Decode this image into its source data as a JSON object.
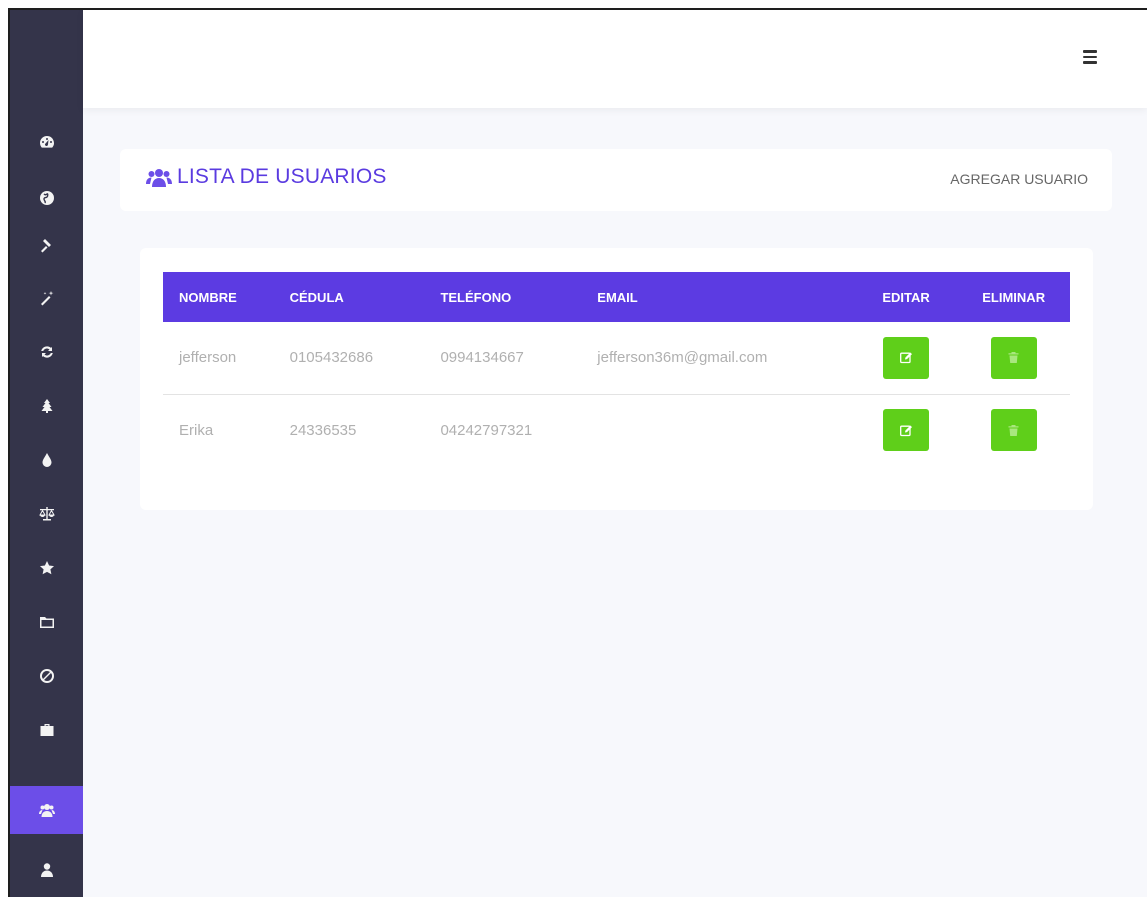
{
  "sidebar": {
    "items": [
      {
        "icon": "dashboard-icon"
      },
      {
        "icon": "globe-icon"
      },
      {
        "icon": "gavel-icon"
      },
      {
        "icon": "magic-wand-icon"
      },
      {
        "icon": "refresh-icon"
      },
      {
        "icon": "tree-icon"
      },
      {
        "icon": "tint-icon"
      },
      {
        "icon": "balance-scale-icon"
      },
      {
        "icon": "star-icon"
      },
      {
        "icon": "folder-icon"
      },
      {
        "icon": "ban-icon"
      },
      {
        "icon": "briefcase-icon"
      },
      {
        "icon": "users-icon",
        "active": true
      },
      {
        "icon": "user-icon"
      }
    ]
  },
  "header": {
    "title": "LISTA DE USUARIOS",
    "add_label": "AGREGAR USUARIO"
  },
  "table": {
    "columns": [
      "NOMBRE",
      "CÉDULA",
      "TELÉFONO",
      "EMAIL",
      "EDITAR",
      "ELIMINAR"
    ],
    "rows": [
      {
        "nombre": "jefferson",
        "cedula": "0105432686",
        "telefono": "0994134667",
        "email": "jefferson36m@gmail.com"
      },
      {
        "nombre": "Erika",
        "cedula": "24336535",
        "telefono": "04242797321",
        "email": ""
      }
    ]
  },
  "colors": {
    "sidebar_bg": "#34344a",
    "accent": "#5c3be2",
    "active_item": "#6c4ee8",
    "action_button": "#5fcf1a"
  }
}
